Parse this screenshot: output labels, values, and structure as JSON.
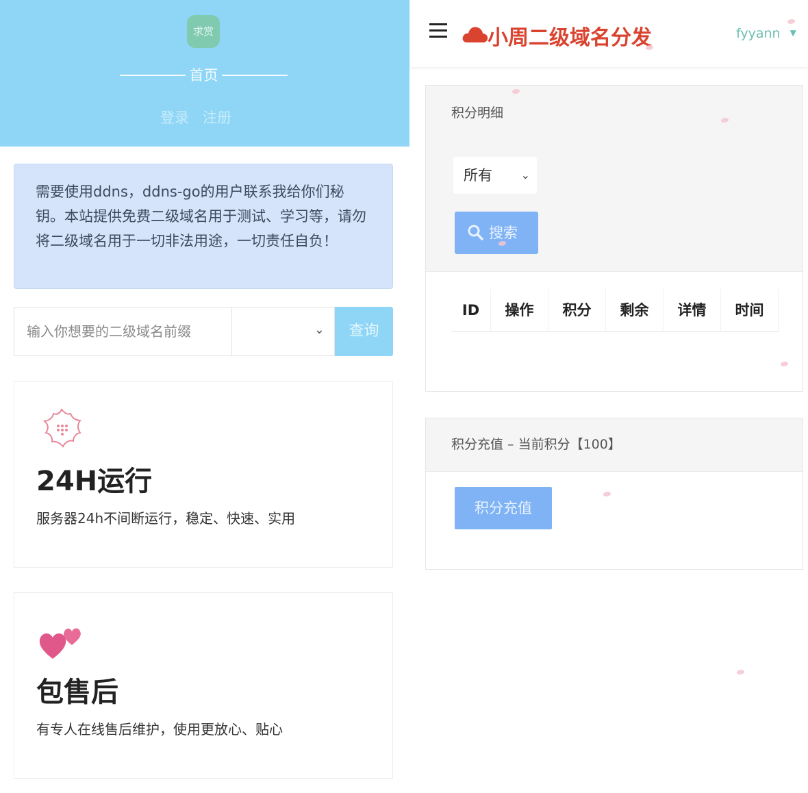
{
  "left": {
    "hero": {
      "logo_text": "求赏",
      "home_label": "首页",
      "login": "登录",
      "register": "注册"
    },
    "notice_text": "需要使用ddns，ddns-go的用户联系我给你们秘钥。本站提供免费二级域名用于测试、学习等，请勿将二级域名用于一切非法用途，一切责任自负！",
    "search": {
      "placeholder": "输入你想要的二级域名前缀",
      "select_value": "",
      "button": "查询"
    },
    "features": [
      {
        "icon": "sakura-icon",
        "title": "24H运行",
        "desc": "服务器24h不间断运行，稳定、快速、实用"
      },
      {
        "icon": "hearts-icon",
        "title": "包售后",
        "desc": "有专人在线售后维护，使用更放心、贴心"
      }
    ]
  },
  "right": {
    "brand": "小周二级域名分发",
    "user": "fyyann",
    "points_panel": {
      "title": "积分明细",
      "filter_value": "所有",
      "search_button": "搜索",
      "columns": [
        "ID",
        "操作",
        "积分",
        "剩余",
        "详情",
        "时间"
      ]
    },
    "recharge_panel": {
      "title": "积分充值 – 当前积分【100】",
      "button": "积分充值"
    }
  },
  "colors": {
    "hero_bg": "#8fd6f6",
    "brand_red": "#d9432f",
    "button_blue": "#7fb3f5",
    "notice_bg": "#d5e3fb"
  }
}
